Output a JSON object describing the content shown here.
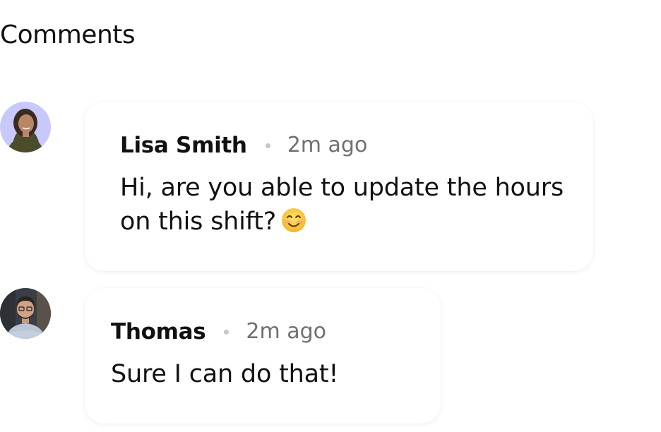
{
  "section": {
    "title": "Comments"
  },
  "comments": [
    {
      "author": "Lisa Smith",
      "timestamp": "2m ago",
      "text": "Hi, are you able to update the hours on this shift?",
      "emoji": "smiling-face",
      "avatar_icon": "avatar-lisa",
      "avatar_bg": "#c9c8fb"
    },
    {
      "author": "Thomas",
      "timestamp": "2m ago",
      "text": "Sure I can do that!",
      "avatar_icon": "avatar-thomas",
      "avatar_bg": "#3b3f45"
    }
  ]
}
